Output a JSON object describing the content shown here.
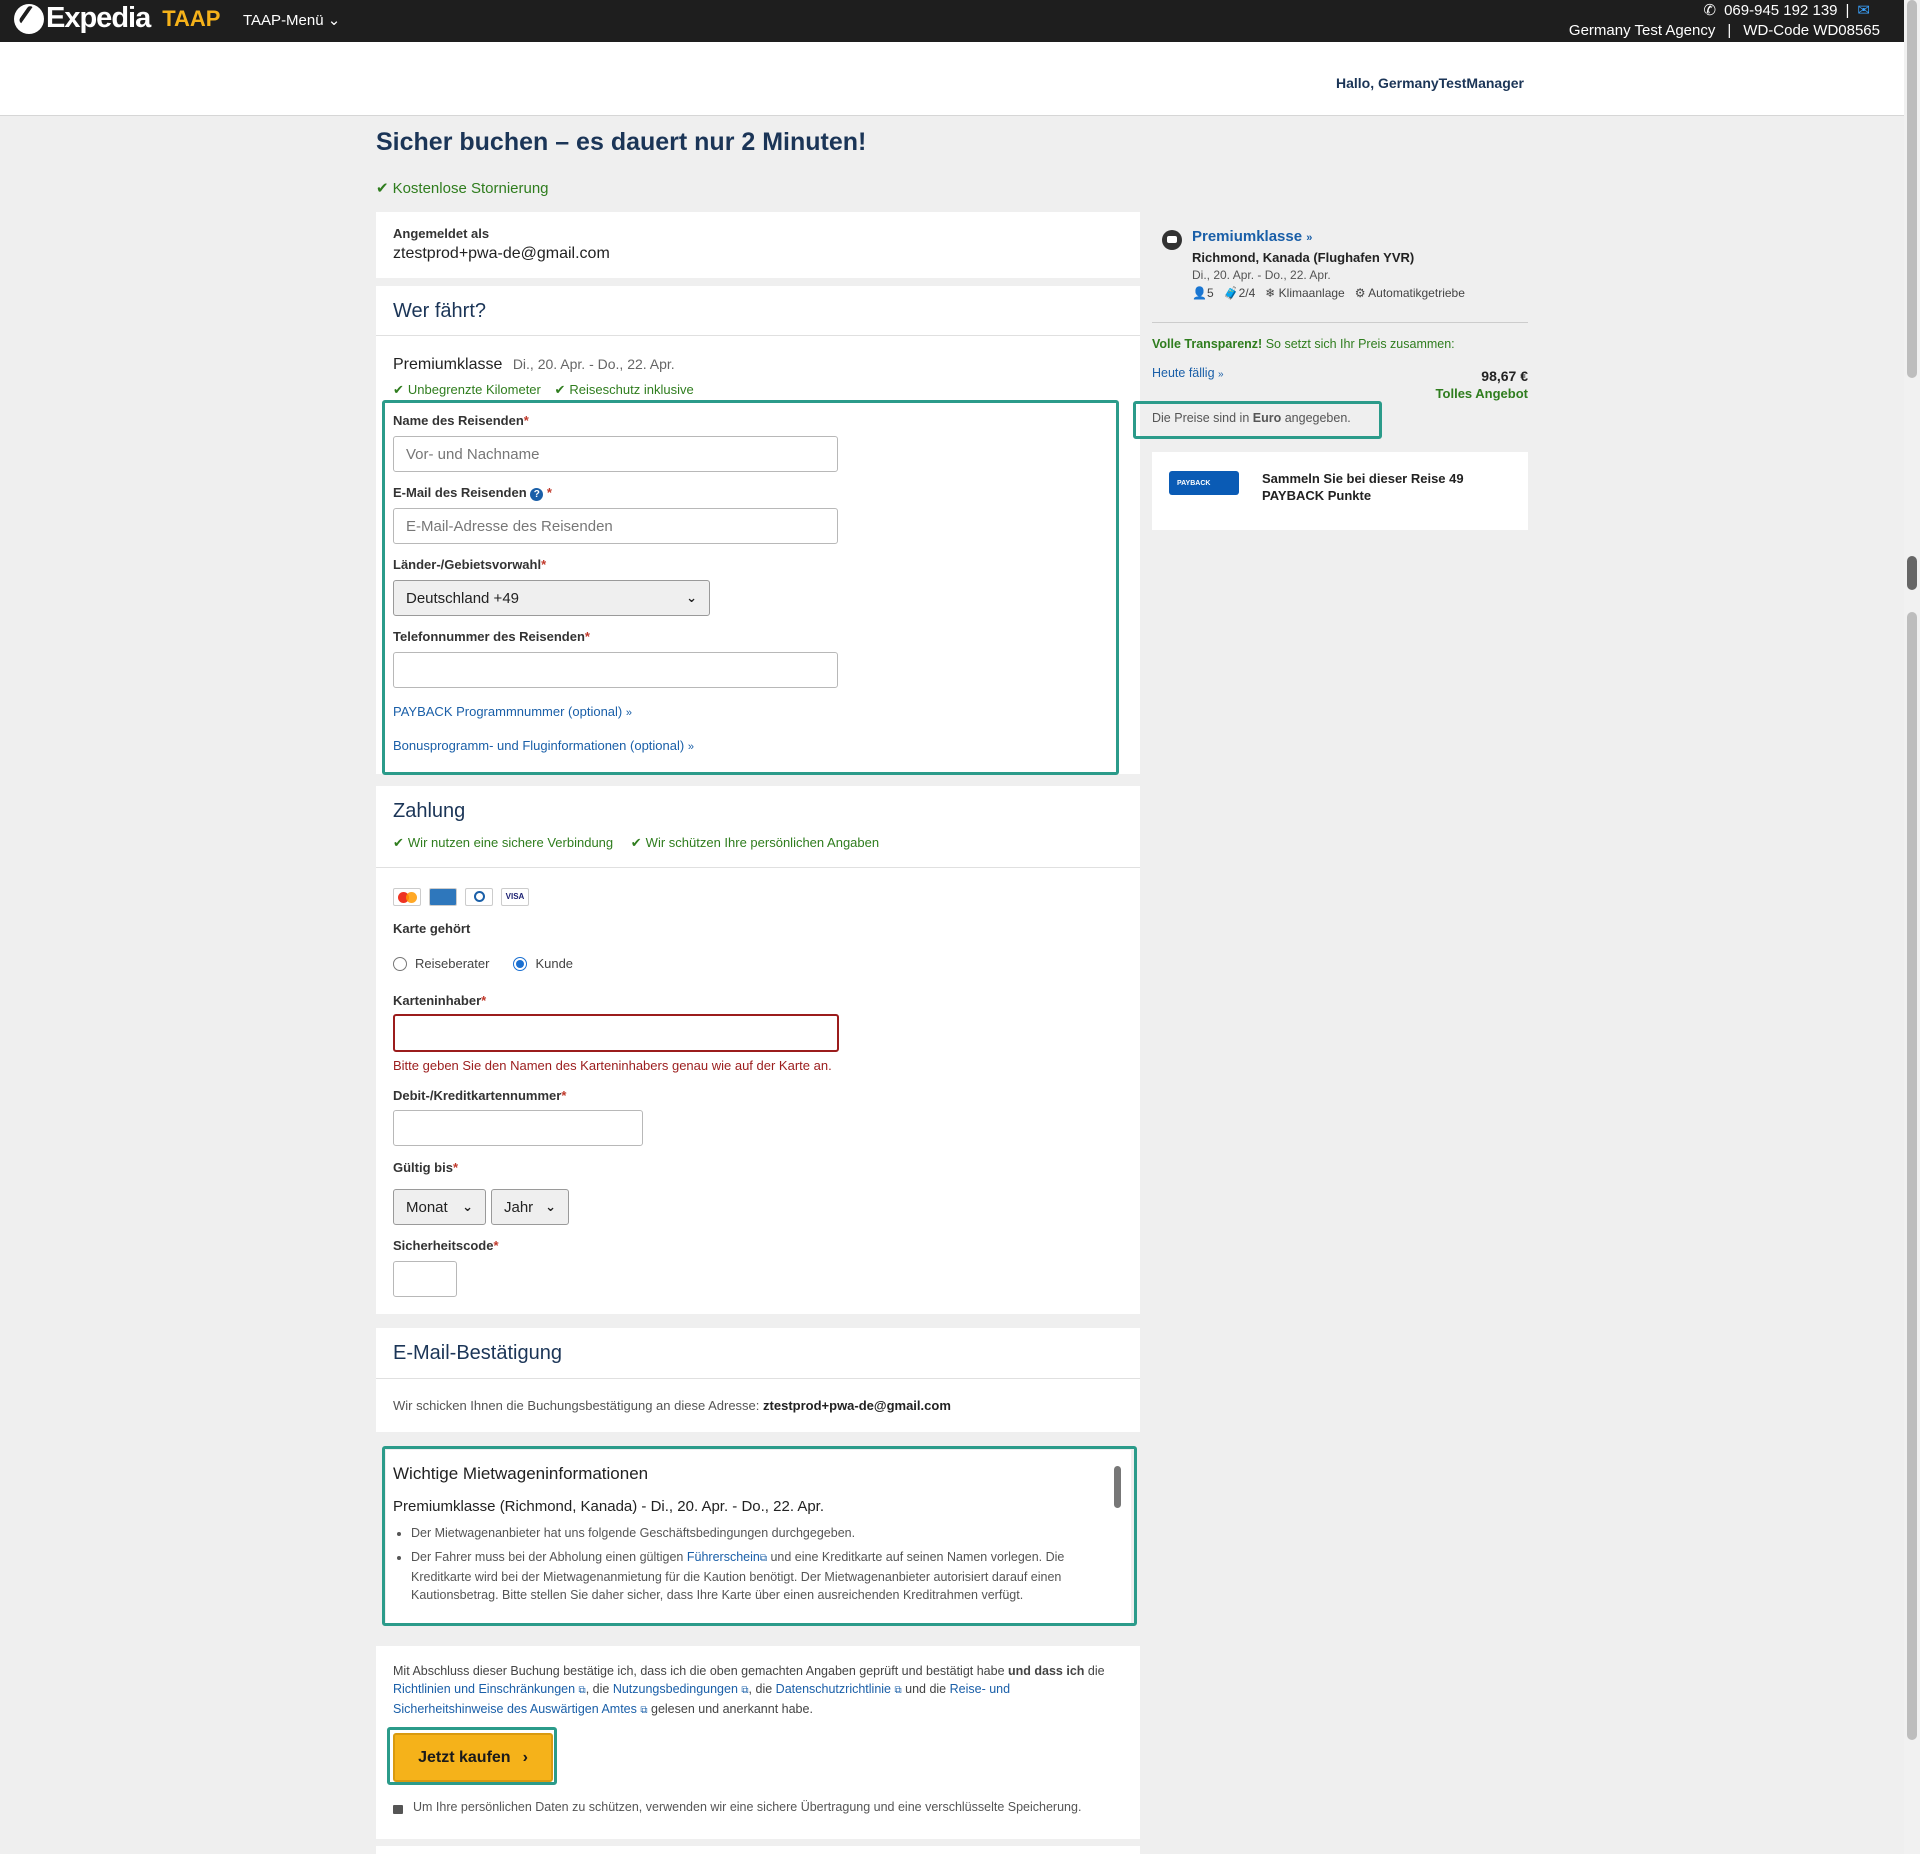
{
  "topbar": {
    "brand": "Expedia",
    "brand_sub": "TAAP",
    "menu_label": "TAAP-Menü",
    "phone": "069-945 192 139",
    "agency": "Germany Test Agency",
    "wd_code": "WD-Code WD08565"
  },
  "header": {
    "greeting": "Hallo, GermanyTestManager"
  },
  "page": {
    "title": "Sicher buchen – es dauert nur 2 Minuten!",
    "free_cancel": "Kostenlose Stornierung"
  },
  "login": {
    "label": "Angemeldet als",
    "email": "ztestprod+pwa-de@gmail.com"
  },
  "traveler": {
    "heading": "Wer fährt?",
    "car_class": "Premiumklasse",
    "dates": "Di., 20. Apr. - Do., 22. Apr.",
    "feature1": "Unbegrenzte Kilometer",
    "feature2": "Reiseschutz inklusive",
    "name_label": "Name des Reisenden",
    "name_placeholder": "Vor- und Nachname",
    "email_label": "E-Mail des Reisenden",
    "email_placeholder": "E-Mail-Adresse des Reisenden",
    "country_label": "Länder-/Gebietsvorwahl",
    "country_value": "Deutschland +49",
    "phone_label": "Telefonnummer des Reisenden",
    "phone_value": "",
    "payback_link": "PAYBACK Programmnummer (optional)",
    "bonus_link": "Bonusprogramm- und Fluginformationen (optional)"
  },
  "payment": {
    "heading": "Zahlung",
    "secure1": "Wir nutzen eine sichere Verbindung",
    "secure2": "Wir schützen Ihre persönlichen Angaben",
    "card_owner_label": "Karte gehört",
    "radio_agent": "Reiseberater",
    "radio_customer": "Kunde",
    "holder_label": "Karteninhaber",
    "holder_error": "Bitte geben Sie den Namen des Karteninhabers genau wie auf der Karte an.",
    "number_label": "Debit-/Kreditkartennummer",
    "valid_label": "Gültig bis",
    "month_value": "Monat",
    "year_value": "Jahr",
    "cvv_label": "Sicherheitscode",
    "cards": [
      "mastercard-icon",
      "amex-icon",
      "diners-icon",
      "visa-icon"
    ],
    "visa_text": "VISA"
  },
  "email_confirm": {
    "heading": "E-Mail-Bestätigung",
    "text": "Wir schicken Ihnen die Buchungsbestätigung an diese Adresse:",
    "email": "ztestprod+pwa-de@gmail.com"
  },
  "rental_info": {
    "heading": "Wichtige Mietwageninformationen",
    "subheading": "Premiumklasse (Richmond, Kanada) - Di., 20. Apr. - Do., 22. Apr.",
    "bullet1": "Der Mietwagenanbieter hat uns folgende Geschäftsbedingungen durchgegeben.",
    "bullet2_a": "Der Fahrer muss bei der Abholung einen gültigen",
    "bullet2_link": "Führerschein",
    "bullet2_b": "und eine Kreditkarte auf seinen Namen vorlegen. Die Kreditkarte wird bei der Mietwagenanmietung für die Kaution benötigt. Der Mietwagenanbieter autorisiert darauf einen Kautionsbetrag. Bitte stellen Sie daher sicher, dass Ihre Karte über einen ausreichenden Kreditrahmen verfügt."
  },
  "terms": {
    "t1": "Mit Abschluss dieser Buchung bestätige ich, dass ich die oben gemachten Angaben geprüft und bestätigt habe",
    "t1_bold": "und dass ich",
    "t2": "die",
    "link1": "Richtlinien und Einschränkungen",
    "t3": ", die",
    "link2": "Nutzungsbedingungen",
    "t4": ", die",
    "link3": "Datenschutzrichtlinie",
    "t5": "und die",
    "link4a": "Reise- und",
    "link4b": "Sicherheitshinweise des Auswärtigen Amtes",
    "t6": "gelesen und anerkannt habe.",
    "buy_button": "Jetzt kaufen",
    "secure_note": "Um Ihre persönlichen Daten zu schützen, verwenden wir eine sichere Übertragung und eine verschlüsselte Speicherung."
  },
  "sidebar": {
    "car_class": "Premiumklasse",
    "location": "Richmond, Kanada (Flughafen YVR)",
    "dates": "Di., 20. Apr. - Do., 22. Apr.",
    "seats": "5",
    "bags": "2/4",
    "ac": "Klimaanlage",
    "transmission": "Automatikgetriebe",
    "transparency_bold": "Volle Transparenz!",
    "transparency_text": "So setzt sich Ihr Preis zusammen:",
    "due_today": "Heute fällig",
    "price": "98,67 €",
    "deal": "Tolles Angebot",
    "currency_a": "Die Preise sind in",
    "currency_bold": "Euro",
    "currency_b": "angegeben.",
    "payback_text": "Sammeln Sie bei dieser Reise 49 PAYBACK Punkte",
    "payback_logo": "PAYBACK"
  },
  "colors": {
    "accent": "#2b9b8a",
    "buy": "#f5b21a",
    "navy": "#1b3557",
    "green": "#2f7d1e",
    "error": "#9b1c1c"
  }
}
